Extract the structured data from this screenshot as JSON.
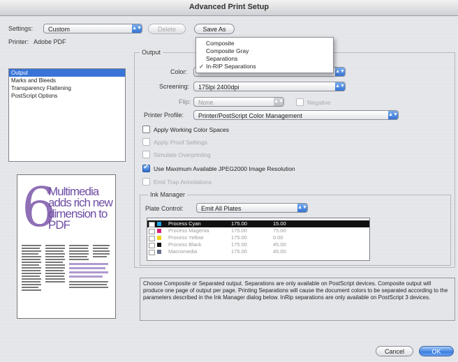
{
  "window": {
    "title": "Advanced Print Setup"
  },
  "settings": {
    "label": "Settings:",
    "value": "Custom"
  },
  "toolbar": {
    "delete_label": "Delete",
    "save_as_label": "Save As"
  },
  "printer": {
    "label": "Printer:",
    "value": "Adobe PDF"
  },
  "sidebar": {
    "items": [
      {
        "label": "Output",
        "selected": true
      },
      {
        "label": "Marks and Bleeds",
        "selected": false
      },
      {
        "label": "Transparency Flattening",
        "selected": false
      },
      {
        "label": "PostScript Options",
        "selected": false
      }
    ]
  },
  "preview": {
    "big_number": "6",
    "headline": "Multimedia adds rich new dimension to PDF"
  },
  "output": {
    "group_label": "Output",
    "color_label": "Color:",
    "screening_label": "Screening:",
    "screening_value": "175lpi 2400dpi",
    "flip_label": "Flip:",
    "flip_value": "None",
    "negative_label": "Negative",
    "printer_profile_label": "Printer Profile:",
    "printer_profile_value": "Printer/PostScript Color Management"
  },
  "color_menu": {
    "items": [
      {
        "label": "Composite",
        "checked": false
      },
      {
        "label": "Composite Gray",
        "checked": false
      },
      {
        "label": "Separations",
        "checked": false
      },
      {
        "label": "In-RIP Separations",
        "checked": true
      }
    ],
    "check_glyph": "✓"
  },
  "options": {
    "apply_working": "Apply Working Color Spaces",
    "apply_proof": "Apply Proof Settings",
    "simulate": "Simulate Overprinting",
    "use_max": "Use Maximum Available JPEG2000 Image Resolution",
    "emit_trap": "Emit Trap Annotations"
  },
  "ink_manager": {
    "group_label": "Ink Manager",
    "plate_control_label": "Plate Control:",
    "plate_control_value": "Emit All Plates",
    "rows": [
      {
        "name": "Process Cyan",
        "freq": "175.00",
        "angle": "15.00",
        "color": "#1aa3e0"
      },
      {
        "name": "Process Magenta",
        "freq": "175.00",
        "angle": "75.00",
        "color": "#d6207a"
      },
      {
        "name": "Process Yellow",
        "freq": "175.00",
        "angle": "0.00",
        "color": "#f1d21a"
      },
      {
        "name": "Process Black",
        "freq": "175.00",
        "angle": "45.00",
        "color": "#111111"
      },
      {
        "name": "Macromedia",
        "freq": "175.00",
        "angle": "45.00",
        "color": "#6a6f8a"
      }
    ]
  },
  "description": "Choose Composite or Separated output. Separations are only available on PostScript devices. Composite output will produce one page of output per page. Printing Separations will cause the document colors to be separated according to the parameters described in the Ink Manager dialog below. InRip separations are only available on PostScript 3 devices.",
  "buttons": {
    "cancel_label": "Cancel",
    "ok_label": "OK"
  }
}
